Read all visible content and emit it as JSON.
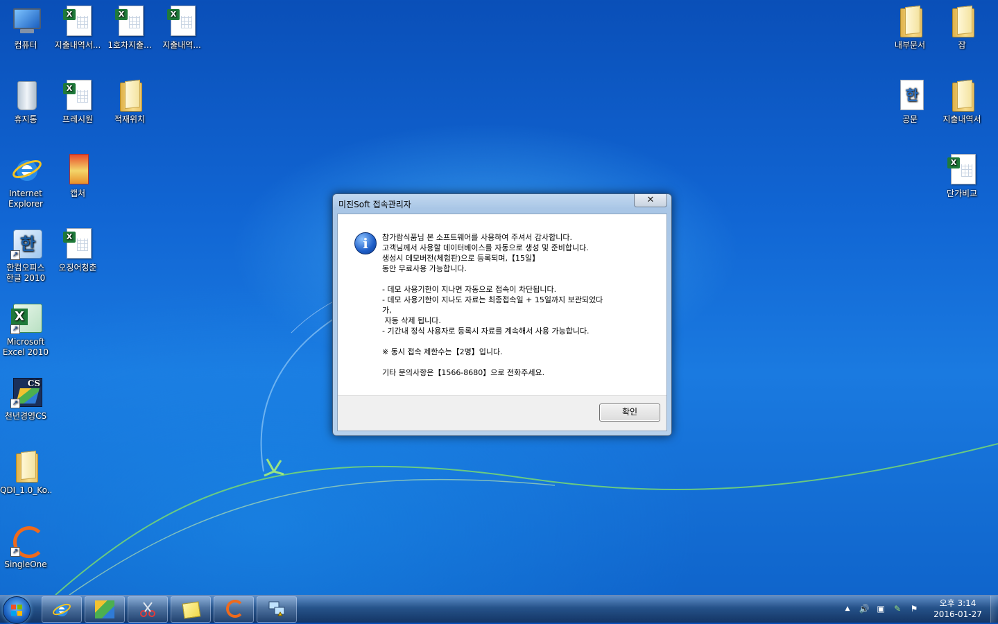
{
  "desktop": {
    "icons": [
      {
        "label": "컴퓨터"
      },
      {
        "label": "지출내역서..."
      },
      {
        "label": "1호차지출..."
      },
      {
        "label": "지출내역..."
      },
      {
        "label": "휴지통"
      },
      {
        "label": "프레시원"
      },
      {
        "label": "적재위치"
      },
      {
        "label": "Internet\nExplorer"
      },
      {
        "label": "캡처"
      },
      {
        "label": "한컴오피스\n한글 2010"
      },
      {
        "label": "오징어청춘"
      },
      {
        "label": "Microsoft\nExcel 2010"
      },
      {
        "label": "천년경영CS"
      },
      {
        "label": "QDI_1.0_Ko..."
      },
      {
        "label": "SingleOne"
      },
      {
        "label": "내부문서"
      },
      {
        "label": "잡"
      },
      {
        "label": "공문"
      },
      {
        "label": "지출내역서"
      },
      {
        "label": "단가비교"
      }
    ]
  },
  "dialog": {
    "title": "미진Soft 접속관리자",
    "close_glyph": "✕",
    "icon": "info-icon",
    "ok_label": "확인",
    "lines": [
      "참가람식품님 본 소프트웨어를 사용하여 주셔서 감사합니다.",
      "고객님께서 사용할 데이터베이스를 자동으로 생성 및 준비합니다.",
      "생성시 데모버전(체험판)으로 등록되며,【15일】",
      "동안 무료사용 가능합니다.",
      "",
      "- 데모 사용기한이 지나면 자동으로 접속이 차단됩니다.",
      "- 데모 사용기한이 지나도 자료는 최종접속일 + 15일까지 보관되었다",
      "가,",
      " 자동 삭제 됩니다.",
      "- 기간내 정식 사용자로 등록시 자료를 계속해서 사용 가능합니다.",
      "",
      "※ 동시 접속 제한수는【2명】입니다.",
      "",
      "기타 문의사항은【1566-8680】으로 전화주세요."
    ]
  },
  "taskbar": {
    "clock_time": "오후 3:14",
    "clock_date": "2016-01-27",
    "tray_up_glyph": "▲",
    "tray_volume_glyph": "🔊",
    "tray_network_glyph": "▣",
    "tray_pen_glyph": "✎",
    "tray_flag_glyph": "⚑"
  },
  "colors": {
    "accent": "#1166d4",
    "dialog_frame": "#b7d1ec",
    "info_blue": "#1e5ec8"
  }
}
